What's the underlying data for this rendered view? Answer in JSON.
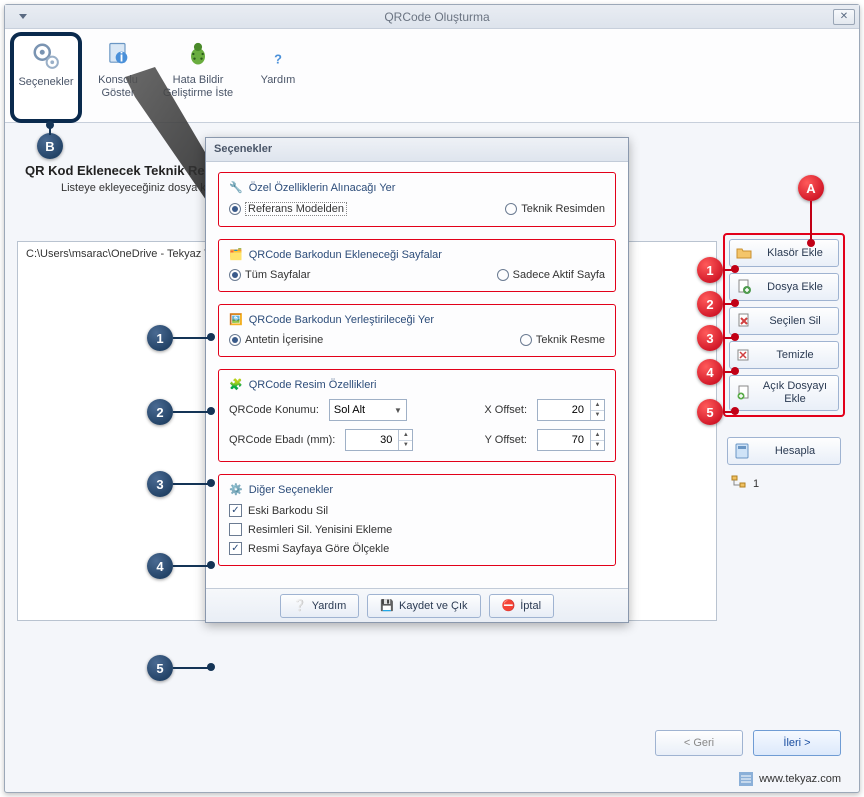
{
  "window": {
    "title": "QRCode Oluşturma"
  },
  "ribbon": {
    "items": [
      {
        "label": "Seçenekler"
      },
      {
        "label": "Konsolu Göster"
      },
      {
        "label": "Hata Bildir Geliştirme İste"
      },
      {
        "label": "Yardım"
      }
    ]
  },
  "page": {
    "heading": "QR Kod Eklenecek Teknik Resileri Seçiniz",
    "subheading": "Listeye ekleyeceğiniz dosya konumlarındaki tüm teknik resimler işleme alınacaktır.",
    "path": "C:\\Users\\msarac\\OneDrive - Tekyaz Teknolojik Yazilimlar Makina Tic\\Masaüstü\\BLOG\\20-TekyazXpert - QR Barkod Olu"
  },
  "side": {
    "items": [
      {
        "label": "Klasör Ekle"
      },
      {
        "label": "Dosya Ekle"
      },
      {
        "label": "Seçilen Sil"
      },
      {
        "label": "Temizle"
      },
      {
        "label": "Açık Dosyayı Ekle"
      }
    ],
    "calculate": "Hesapla",
    "count": "1"
  },
  "popup": {
    "title": "Seçenekler",
    "group1": {
      "title": "Özel Özelliklerin Alınacağı Yer",
      "opt1": "Referans Modelden",
      "opt2": "Teknik Resimden"
    },
    "group2": {
      "title": "QRCode Barkodun Ekleneceği Sayfalar",
      "opt1": "Tüm Sayfalar",
      "opt2": "Sadece Aktif Sayfa"
    },
    "group3": {
      "title": "QRCode Barkodun Yerleştirileceği Yer",
      "opt1": "Antetin İçerisine",
      "opt2": "Teknik Resme"
    },
    "group4": {
      "title": "QRCode Resim Özellikleri",
      "pos_label": "QRCode Konumu:",
      "pos_value": "Sol Alt",
      "size_label": "QRCode Ebadı (mm):",
      "size_value": "30",
      "xoff_label": "X Offset:",
      "xoff_value": "20",
      "yoff_label": "Y Offset:",
      "yoff_value": "70"
    },
    "group5": {
      "title": "Diğer Seçenekler",
      "chk1": "Eski Barkodu Sil",
      "chk2": "Resimleri Sil. Yenisini Ekleme",
      "chk3": "Resmi Sayfaya Göre Ölçekle"
    },
    "footer": {
      "help": "Yardım",
      "save": "Kaydet ve Çık",
      "cancel": "İptal"
    }
  },
  "wizard": {
    "back": "< Geri",
    "next": "İleri >"
  },
  "brand": "www.tekyaz.com",
  "annotations": {
    "A": "A",
    "B": "B",
    "n1": "1",
    "n2": "2",
    "n3": "3",
    "n4": "4",
    "n5": "5"
  }
}
